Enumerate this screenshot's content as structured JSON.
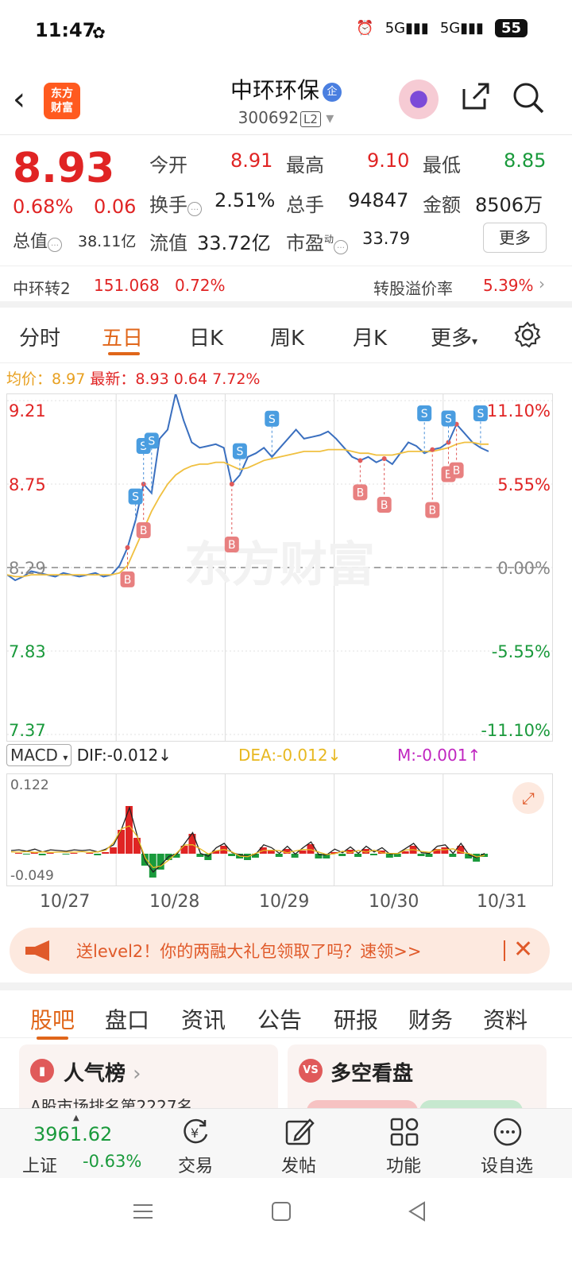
{
  "status_bar": {
    "time": "11:47",
    "battery": "55"
  },
  "header": {
    "title": "中环环保",
    "code": "300692",
    "level": "L2",
    "logo_line1": "东方",
    "logo_line2": "财富"
  },
  "quote": {
    "price": "8.93",
    "pct": "0.68%",
    "change": "0.06",
    "open_label": "今开",
    "open": "8.91",
    "high_label": "最高",
    "high": "9.10",
    "low_label": "最低",
    "low": "8.85",
    "turnover_label": "换手",
    "turnover": "2.51%",
    "volume_label": "总手",
    "volume": "94847",
    "amount_label": "金额",
    "amount": "8506万",
    "mktcap_label": "总值",
    "mktcap": "38.11亿",
    "float_label": "流值",
    "float": "33.72亿",
    "pe_label": "市盈",
    "pe_sup": "动",
    "pe": "33.79",
    "more": "更多"
  },
  "convertible": {
    "name": "中环转2",
    "price": "151.068",
    "pct": "0.72%",
    "premium_label": "转股溢价率",
    "premium": "5.39%"
  },
  "chart_tabs": [
    "分时",
    "五日",
    "日K",
    "周K",
    "月K",
    "更多"
  ],
  "chart_info": {
    "avg_label": "均价：",
    "avg": "8.97",
    "latest_label": "最新：",
    "latest": "8.93",
    "chg": "0.64",
    "chg_pct": "7.72%"
  },
  "chart_data": {
    "type": "line",
    "x": [
      "10/27",
      "10/28",
      "10/29",
      "10/30",
      "10/31"
    ],
    "y_ticks_left": [
      "9.21",
      "8.75",
      "8.29",
      "7.83",
      "7.37"
    ],
    "y_ticks_right": [
      "11.10%",
      "5.55%",
      "0.00%",
      "-5.55%",
      "-11.10%"
    ],
    "ylim": [
      7.37,
      9.21
    ],
    "prev_close": 8.29,
    "watermark": "东方财富",
    "series": [
      {
        "values": [
          8.25,
          8.22,
          8.24,
          8.27,
          8.26,
          8.25,
          8.24,
          8.26,
          8.25,
          8.24,
          8.25,
          8.26,
          8.24,
          8.25,
          8.3,
          8.4,
          8.55,
          8.75,
          8.7,
          9.0,
          9.05,
          9.25,
          9.1,
          8.98,
          8.95,
          8.96,
          8.97,
          8.95,
          8.75,
          8.8,
          8.9,
          8.92,
          8.95,
          8.9,
          8.95,
          9.0,
          9.05,
          9.0,
          9.01,
          9.02,
          9.04,
          9.0,
          8.95,
          8.9,
          8.88,
          8.9,
          8.87,
          8.89,
          8.86,
          8.92,
          8.98,
          8.96,
          8.92,
          8.94,
          8.95,
          8.98,
          9.08,
          9.03,
          8.98,
          8.95,
          8.93
        ]
      },
      {
        "values": [
          8.25,
          8.24,
          8.24,
          8.25,
          8.25,
          8.25,
          8.25,
          8.25,
          8.25,
          8.25,
          8.25,
          8.25,
          8.25,
          8.25,
          8.26,
          8.3,
          8.4,
          8.5,
          8.6,
          8.68,
          8.75,
          8.8,
          8.83,
          8.85,
          8.86,
          8.86,
          8.87,
          8.87,
          8.85,
          8.83,
          8.84,
          8.86,
          8.88,
          8.89,
          8.9,
          8.91,
          8.92,
          8.93,
          8.93,
          8.93,
          8.94,
          8.94,
          8.94,
          8.93,
          8.92,
          8.92,
          8.91,
          8.91,
          8.91,
          8.92,
          8.93,
          8.93,
          8.93,
          8.93,
          8.94,
          8.95,
          8.97,
          8.98,
          8.98,
          8.97,
          8.97
        ]
      }
    ],
    "markers": {
      "buy": "B",
      "sell": "S"
    }
  },
  "macd": {
    "label": "MACD",
    "dif": "DIF:-0.012↓",
    "dea": "DEA:-0.012↓",
    "m": "M:-0.001↑",
    "top": "0.122",
    "bottom": "-0.049"
  },
  "banner": {
    "text": "送level2！你的两融大礼包领取了吗？速领>>"
  },
  "bottom_tabs": [
    "股吧",
    "盘口",
    "资讯",
    "公告",
    "研报",
    "财务",
    "资料"
  ],
  "cards": {
    "popularity": "人气榜",
    "rank_text": "A股市场排名第2227名",
    "bullbear": "多空看盘"
  },
  "index": {
    "value": "3961.62",
    "name": "上证",
    "pct": "-0.63%"
  },
  "nav": [
    "交易",
    "发帖",
    "功能",
    "设自选"
  ],
  "colors": {
    "up": "#e02424",
    "down": "#1a9a3c",
    "accent": "#e0661a",
    "price_line": "#3a6fbf",
    "avg_line": "#f0c040"
  }
}
